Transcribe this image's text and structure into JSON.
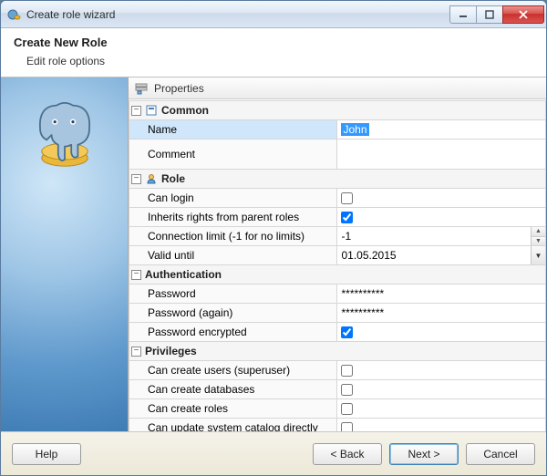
{
  "window": {
    "title": "Create role wizard"
  },
  "header": {
    "title": "Create New Role",
    "subtitle": "Edit role options"
  },
  "panel": {
    "title": "Properties"
  },
  "groups": {
    "common": {
      "label": "Common",
      "name": {
        "label": "Name",
        "value": "John"
      },
      "comment": {
        "label": "Comment",
        "value": ""
      }
    },
    "role": {
      "label": "Role",
      "can_login": {
        "label": "Can login",
        "checked": false
      },
      "inherits": {
        "label": "Inherits rights from parent roles",
        "checked": true
      },
      "conn_limit": {
        "label": "Connection limit (-1 for no limits)",
        "value": "-1"
      },
      "valid_until": {
        "label": "Valid until",
        "value": "01.05.2015"
      }
    },
    "auth": {
      "label": "Authentication",
      "password": {
        "label": "Password",
        "value": "**********"
      },
      "password2": {
        "label": "Password (again)",
        "value": "**********"
      },
      "encrypted": {
        "label": "Password encrypted",
        "checked": true
      }
    },
    "priv": {
      "label": "Privileges",
      "superuser": {
        "label": "Can create users (superuser)",
        "checked": false
      },
      "create_db": {
        "label": "Can create databases",
        "checked": false
      },
      "create_roles": {
        "label": "Can create roles",
        "checked": false
      },
      "update_catalog": {
        "label": "Can update system catalog directly",
        "checked": false
      }
    }
  },
  "footer": {
    "help": "Help",
    "back": "< Back",
    "next": "Next >",
    "cancel": "Cancel"
  }
}
